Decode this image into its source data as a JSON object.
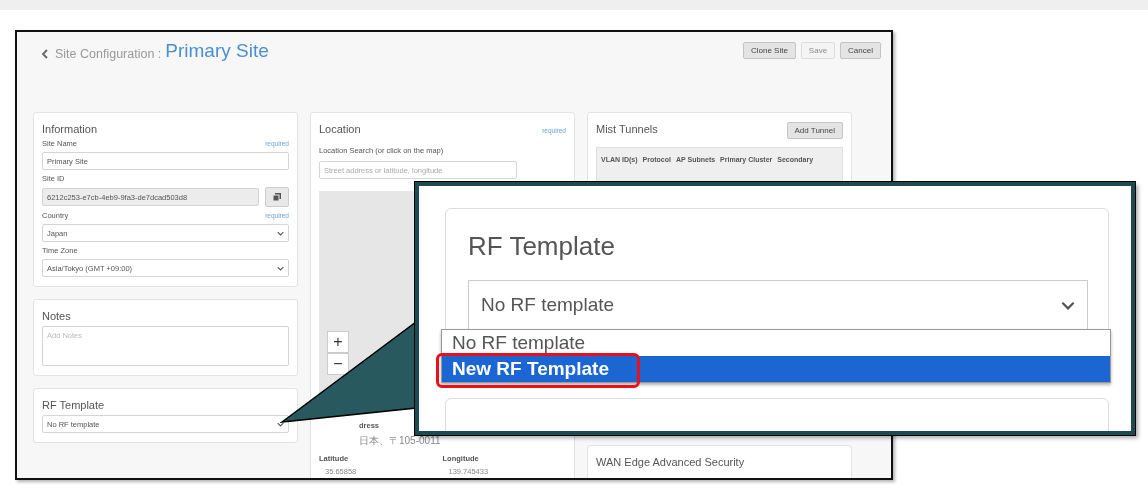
{
  "breadcrumb": "Site Configuration :",
  "title": "Primary Site",
  "buttons": [
    {
      "label": "Clone Site",
      "disabled": false
    },
    {
      "label": "Save",
      "disabled": true
    },
    {
      "label": "Cancel",
      "disabled": false
    }
  ],
  "information": {
    "title": "Information",
    "fields": [
      {
        "kind": "text",
        "label": "Site Name",
        "required": "required",
        "value": "Primary Site"
      },
      {
        "kind": "copy",
        "label": "Site ID",
        "value": "6212c253-e7cb-4eb9-9fa3-de7dcad503d8"
      },
      {
        "kind": "select",
        "label": "Country",
        "required": "required",
        "value": "Japan"
      },
      {
        "kind": "select",
        "label": "Time Zone",
        "value": "Asia/Tokyo (GMT +09:00)"
      }
    ]
  },
  "notes": {
    "title": "Notes",
    "placeholder": "Add Notes"
  },
  "rf_template": {
    "title": "RF Template",
    "value": "No RF template"
  },
  "location": {
    "title": "Location",
    "required": "required",
    "search_label": "Location Search (or click on the map)",
    "placeholder": "Street address or latitude, longitude",
    "zoom_in": "+",
    "zoom_out": "−",
    "address_label": "dress",
    "address": "日本、〒105-0011",
    "latitude_label": "Latitude",
    "latitude": "35.65858",
    "longitude_label": "Longitude",
    "longitude": "139.745433"
  },
  "mist_tunnels": {
    "title": "Mist Tunnels",
    "add_button": "Add Tunnel",
    "columns": [
      "VLAN ID(s)",
      "Protocol",
      "AP Subnets",
      "Primary Cluster",
      "Secondary"
    ]
  },
  "wan_edge": {
    "title": "WAN Edge Advanced Security"
  },
  "callout": {
    "title": "RF Template",
    "value": "No RF template",
    "options": [
      {
        "label": "No RF template",
        "highlighted": false
      },
      {
        "label": "New RF Template",
        "highlighted": true
      }
    ]
  }
}
